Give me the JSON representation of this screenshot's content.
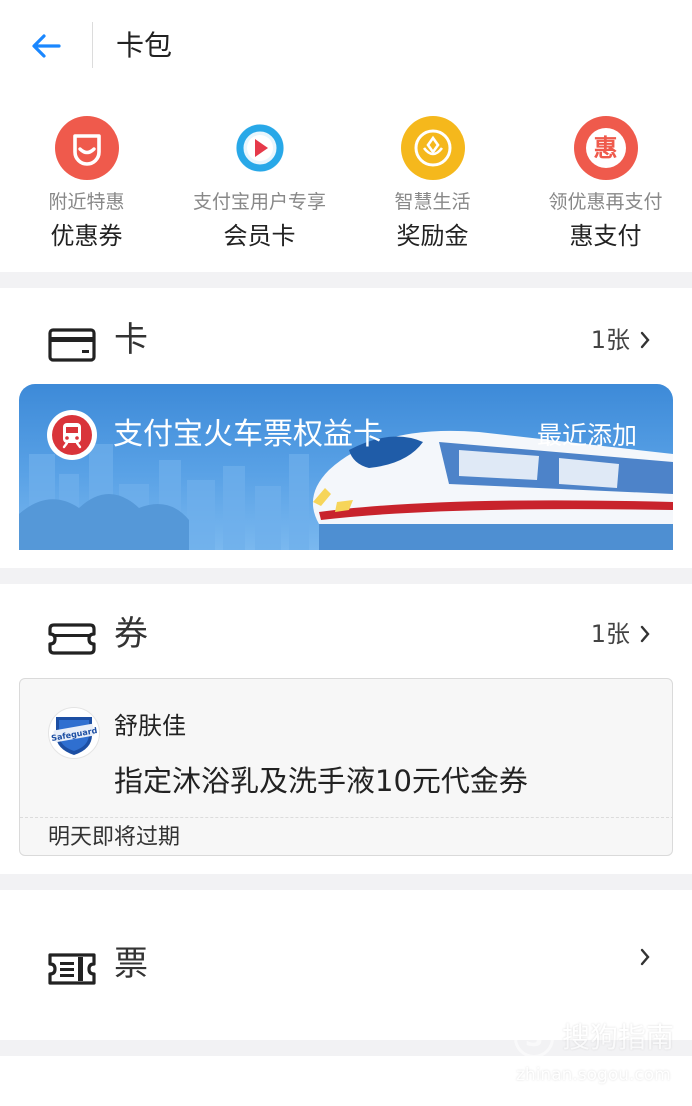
{
  "header": {
    "title": "卡包",
    "back_icon": "arrow-left-icon",
    "accent_color": "#1a87ff"
  },
  "quick_entries": [
    {
      "id": "coupons",
      "subtitle": "附近特惠",
      "label": "优惠券",
      "icon": "smile-bag-icon",
      "color": "#ef5a4c"
    },
    {
      "id": "membership",
      "subtitle": "支付宝用户专享",
      "label": "会员卡",
      "icon": "play-circle-icon",
      "color": "#28a8e8"
    },
    {
      "id": "rewards",
      "subtitle": "智慧生活",
      "label": "奖励金",
      "icon": "flower-coin-icon",
      "color": "#f5b81c"
    },
    {
      "id": "hui-pay",
      "subtitle": "领优惠再支付",
      "label": "惠支付",
      "icon": "hui-badge-icon",
      "color": "#ef5a4c",
      "glyph": "惠"
    }
  ],
  "cards_section": {
    "title": "卡",
    "count": "1张",
    "icon": "card-icon",
    "card": {
      "name": "支付宝火车票权益卡",
      "tag": "最近添加",
      "logo_icon": "train-icon",
      "logo_color": "#d9343a"
    }
  },
  "coupons_section": {
    "title": "券",
    "count": "1张",
    "icon": "coupon-icon",
    "coupon": {
      "brand": "舒肤佳",
      "logo_text": "Safeguard",
      "description": "指定沐浴乳及洗手液10元代金券",
      "expiry": "明天即将过期"
    }
  },
  "tickets_section": {
    "title": "票",
    "icon": "ticket-icon"
  },
  "watermark": {
    "logo_glyph": "S",
    "text": "搜狗指南",
    "url": "zhinan.sogou.com"
  }
}
